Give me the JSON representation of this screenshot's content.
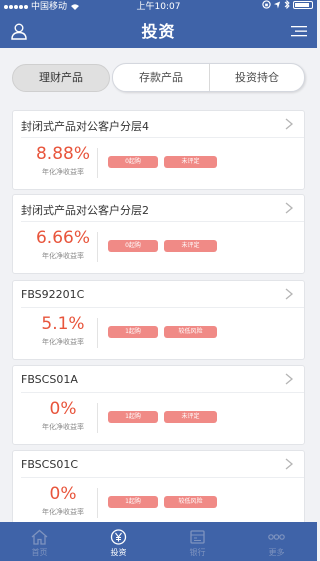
{
  "status_bar": {
    "carrier": "中国移动",
    "time": "上午10:07"
  },
  "header": {
    "title": "投资"
  },
  "tabs": [
    {
      "label": "理财产品",
      "active": true
    },
    {
      "label": "存款产品",
      "active": false
    },
    {
      "label": "投资持仓",
      "active": false
    }
  ],
  "products": [
    {
      "name": "封闭式产品对公客户分层4",
      "rate": "8.88%",
      "rate_label": "年化净收益率",
      "tags": [
        "0起购",
        "未评定"
      ]
    },
    {
      "name": "封闭式产品对公客户分层2",
      "rate": "6.66%",
      "rate_label": "年化净收益率",
      "tags": [
        "0起购",
        "未评定"
      ]
    },
    {
      "name": "FBS92201C",
      "rate": "5.1%",
      "rate_label": "年化净收益率",
      "tags": [
        "1起购",
        "较低风险"
      ]
    },
    {
      "name": "FBSCS01A",
      "rate": "0%",
      "rate_label": "年化净收益率",
      "tags": [
        "1起购",
        "未评定"
      ]
    },
    {
      "name": "FBSCS01C",
      "rate": "0%",
      "rate_label": "年化净收益率",
      "tags": [
        "1起购",
        "较低风险"
      ]
    }
  ],
  "tabbar": [
    {
      "label": "首页",
      "icon": "home-icon",
      "active": false
    },
    {
      "label": "投资",
      "icon": "yen-icon",
      "active": true
    },
    {
      "label": "银行",
      "icon": "bank-icon",
      "active": false
    },
    {
      "label": "更多",
      "icon": "more-icon",
      "active": false
    }
  ],
  "colors": {
    "brand_blue": "#3f63a8",
    "rate_red": "#e8553c",
    "tag_pink": "#f08a86"
  }
}
